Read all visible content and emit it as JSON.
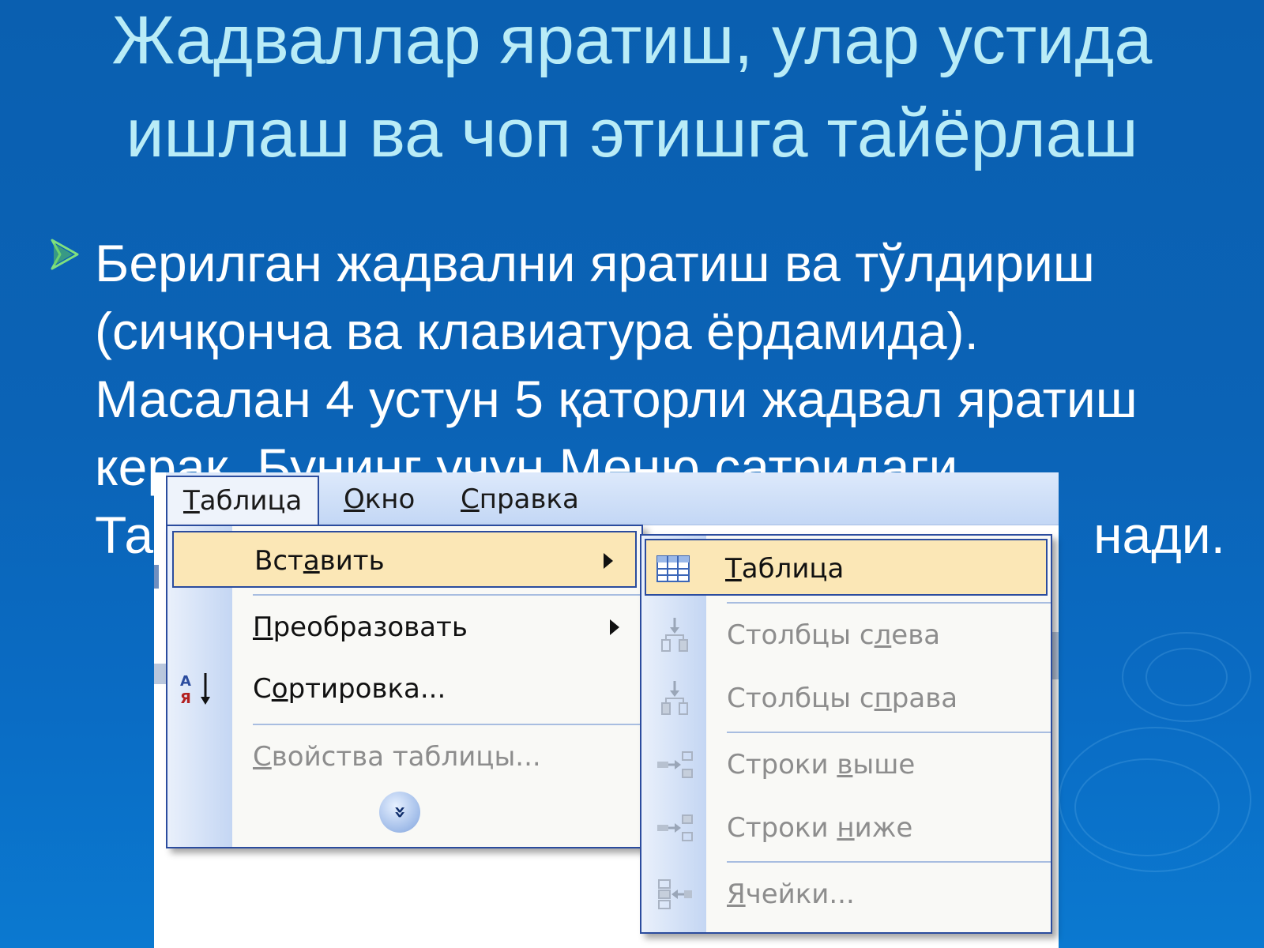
{
  "slide": {
    "title": "Жадваллар яратиш, улар устида ишлаш ва чоп этишга тайёрлаш",
    "bullet_line1": "Берилган жадвални яратиш ва тўлдириш",
    "bullet_line2": "(сичқонча ва клавиатура ёрдамида).",
    "bullet_line3": "Масалан 4 устун 5 қаторли жадвал яратиш",
    "bullet_line4": "керак. Бунинг учун Меню сатридаги",
    "bullet_line5_start": "Та",
    "bullet_line5_end": "нади."
  },
  "menubar": {
    "items": [
      {
        "label": "Таблица",
        "mnemonic": "Т",
        "rest": "аблица",
        "active": true
      },
      {
        "label": "Окно",
        "mnemonic": "О",
        "rest": "кно",
        "active": false
      },
      {
        "label": "Справка",
        "mnemonic": "С",
        "rest": "правка",
        "active": false
      }
    ]
  },
  "main_menu": {
    "items": [
      {
        "label": "Вставить",
        "pre": "Вст",
        "mnemonic": "а",
        "post": "вить",
        "highlighted": true,
        "submenu": true,
        "disabled": false
      },
      {
        "label": "Преобразовать",
        "pre": "",
        "mnemonic": "П",
        "post": "реобразовать",
        "highlighted": false,
        "submenu": true,
        "disabled": false
      },
      {
        "label": "Сортировка...",
        "pre": "С",
        "mnemonic": "о",
        "post": "ртировка...",
        "highlighted": false,
        "submenu": false,
        "disabled": false,
        "icon": "sort-az-icon"
      },
      {
        "label": "Свойства таблицы...",
        "pre": "",
        "mnemonic": "С",
        "post": "войства таблицы...",
        "highlighted": false,
        "submenu": false,
        "disabled": true
      }
    ],
    "expand_glyph": "»",
    "expand_icon": "expand-chevrons-icon"
  },
  "submenu": {
    "items": [
      {
        "label": "Таблица",
        "pre": "",
        "mnemonic": "Т",
        "post": "аблица",
        "highlighted": true,
        "disabled": false,
        "icon": "insert-table-icon"
      },
      {
        "label": "Столбцы слева",
        "pre": "Столбцы с",
        "mnemonic": "л",
        "post": "ева",
        "highlighted": false,
        "disabled": true,
        "icon": "columns-left-icon"
      },
      {
        "label": "Столбцы справа",
        "pre": "Столбцы с",
        "mnemonic": "п",
        "post": "рава",
        "highlighted": false,
        "disabled": true,
        "icon": "columns-right-icon"
      },
      {
        "label": "Строки выше",
        "pre": "Строки ",
        "mnemonic": "в",
        "post": "ыше",
        "highlighted": false,
        "disabled": true,
        "icon": "rows-above-icon"
      },
      {
        "label": "Строки ниже",
        "pre": "Строки ",
        "mnemonic": "н",
        "post": "иже",
        "highlighted": false,
        "disabled": true,
        "icon": "rows-below-icon"
      },
      {
        "label": "Ячейки...",
        "pre": "",
        "mnemonic": "Я",
        "post": "чейки...",
        "highlighted": false,
        "disabled": true,
        "icon": "cells-icon"
      }
    ]
  },
  "colors": {
    "title_text": "#b9ecf7",
    "body_text": "#ffffff",
    "bullet": "#7fe07f",
    "menu_highlight": "#fbe7b6",
    "menu_border": "#2b4c9e"
  }
}
